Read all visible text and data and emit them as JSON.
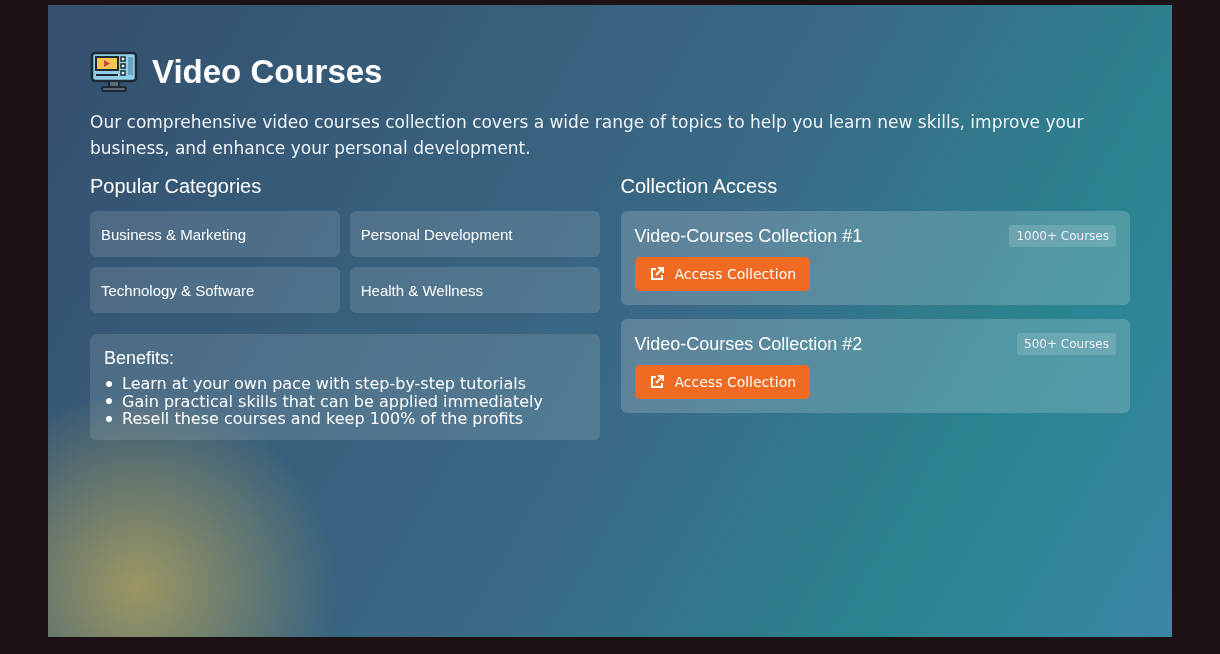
{
  "title": "Video Courses",
  "intro": "Our comprehensive video courses collection covers a wide range of topics to help you learn new skills, improve your business, and enhance your personal development.",
  "categories": {
    "heading": "Popular Categories",
    "items": [
      "Business & Marketing",
      "Personal Development",
      "Technology & Software",
      "Health & Wellness"
    ]
  },
  "benefits": {
    "heading": "Benefits:",
    "items": [
      "Learn at your own pace with step-by-step tutorials",
      "Gain practical skills that can be applied immediately",
      "Resell these courses and keep 100% of the profits"
    ]
  },
  "access": {
    "heading": "Collection Access",
    "collections": [
      {
        "name": "Video-Courses Collection #1",
        "count": "1000+ Courses",
        "button": "Access Collection"
      },
      {
        "name": "Video-Courses Collection #2",
        "count": "500+ Courses",
        "button": "Access Collection"
      }
    ]
  }
}
